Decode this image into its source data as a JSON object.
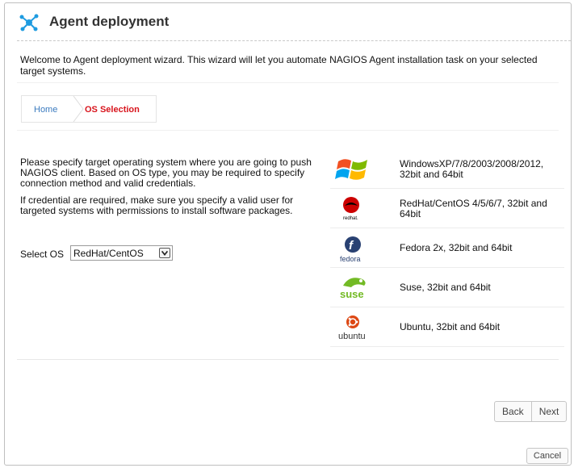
{
  "header": {
    "title": "Agent deployment"
  },
  "welcome": {
    "text": "Welcome to Agent deployment wizard. This wizard will let you automate NAGIOS Agent installation task on your selected target systems."
  },
  "breadcrumb": {
    "home": "Home",
    "current": "OS Selection"
  },
  "instructions": {
    "para1": "Please specify target operating system where you are going to push NAGIOS client. Based on OS type, you may be required to specify connection method and valid credentials.",
    "para2": "If credential are required, make sure you specify a valid user for targeted systems with permissions to install software packages."
  },
  "select_os": {
    "label": "Select OS",
    "value": "RedHat/CentOS"
  },
  "os_list": [
    {
      "icon": "windows-logo-icon",
      "label": "WindowsXP/7/8/2003/2008/2012, 32bit and 64bit"
    },
    {
      "icon": "redhat-logo-icon",
      "label": "RedHat/CentOS 4/5/6/7, 32bit and 64bit",
      "icon_text": "redhat."
    },
    {
      "icon": "fedora-logo-icon",
      "label": "Fedora 2x, 32bit and 64bit",
      "icon_text": "fedora"
    },
    {
      "icon": "suse-logo-icon",
      "label": "Suse, 32bit and 64bit",
      "icon_text": "suse"
    },
    {
      "icon": "ubuntu-logo-icon",
      "label": "Ubuntu, 32bit and 64bit",
      "icon_text": "ubuntu"
    }
  ],
  "nav": {
    "back": "Back",
    "next": "Next",
    "cancel": "Cancel"
  },
  "colors": {
    "accent_red": "#d8141c",
    "link_blue": "#3b7bbf",
    "logo_blue": "#1e9be0"
  }
}
